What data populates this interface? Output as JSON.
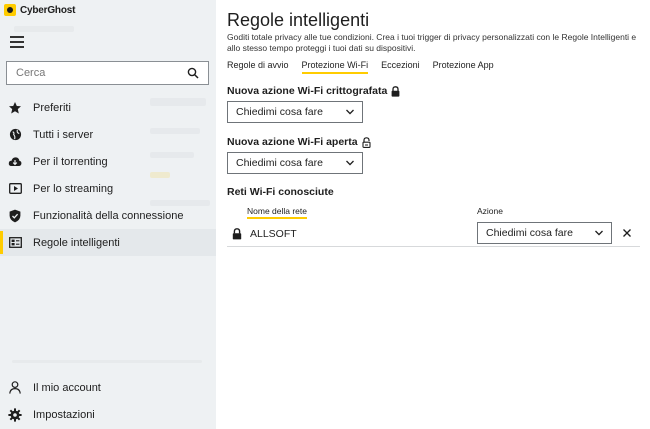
{
  "app": {
    "brand": "CyberGhost"
  },
  "sidebar": {
    "search_placeholder": "Cerca",
    "items": [
      {
        "label": "Preferiti",
        "icon": "star-icon"
      },
      {
        "label": "Tutti i server",
        "icon": "globe-icon"
      },
      {
        "label": "Per il torrenting",
        "icon": "cloud-download-icon"
      },
      {
        "label": "Per lo streaming",
        "icon": "play-icon"
      },
      {
        "label": "Funzionalità della connessione",
        "icon": "shield-icon"
      },
      {
        "label": "Regole intelligenti",
        "icon": "rules-icon",
        "active": true
      }
    ],
    "bottom_items": [
      {
        "label": "Il mio account",
        "icon": "user-icon"
      },
      {
        "label": "Impostazioni",
        "icon": "gear-icon"
      }
    ]
  },
  "main": {
    "title": "Regole intelligenti",
    "description": "Goditi totale privacy alle tue condizioni. Crea i tuoi trigger di privacy personalizzati con le Regole Intelligenti e allo stesso tempo proteggi i tuoi dati su  dispositivi.",
    "tabs": [
      {
        "label": "Regole di avvio"
      },
      {
        "label": "Protezione Wi-Fi",
        "active": true
      },
      {
        "label": "Eccezioni"
      },
      {
        "label": "Protezione App"
      }
    ],
    "encrypted": {
      "label": "Nuova azione Wi-Fi crittografata",
      "value": "Chiedimi cosa fare"
    },
    "open": {
      "label": "Nuova azione Wi-Fi aperta",
      "value": "Chiedimi cosa fare"
    },
    "known": {
      "label": "Reti Wi-Fi conosciute",
      "col_name": "Nome della rete",
      "col_action": "Azione",
      "rows": [
        {
          "name": "ALLSOFT",
          "action": "Chiedimi cosa fare"
        }
      ]
    }
  },
  "colors": {
    "accent": "#ffcc00",
    "sidebar_bg": "#eef1f3",
    "text": "#1e1e1e"
  }
}
